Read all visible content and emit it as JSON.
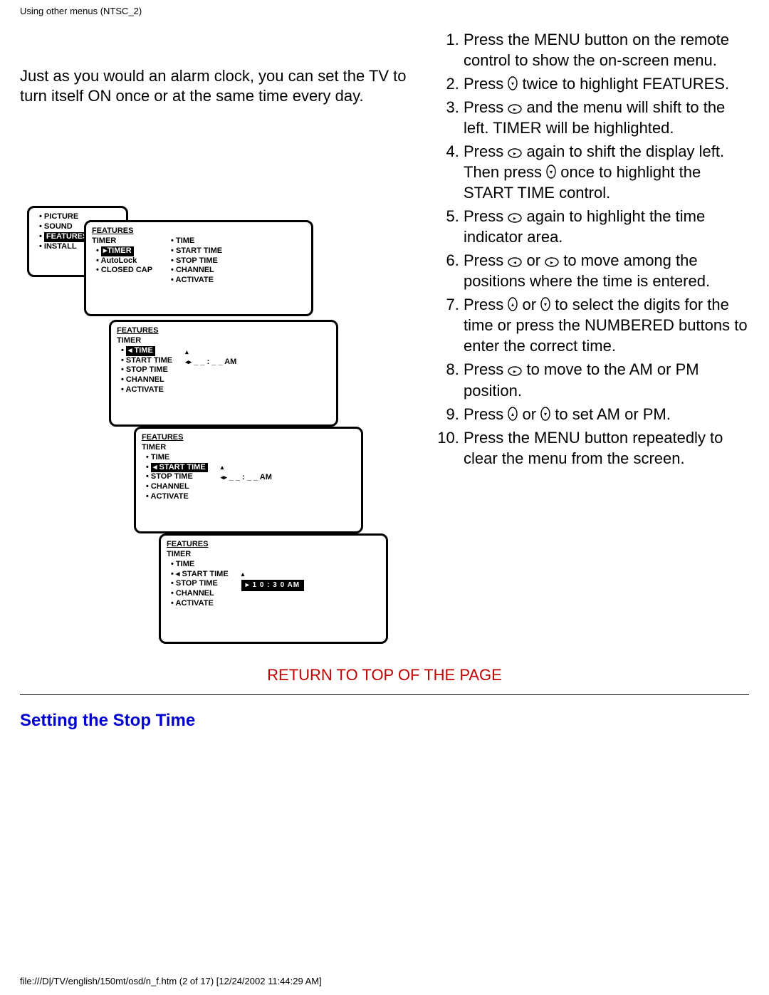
{
  "header_path": "Using other menus (NTSC_2)",
  "footer_path": "file:///D|/TV/english/150mt/osd/n_f.htm (2 of 17) [12/24/2002 11:44:29 AM]",
  "intro": "Just as you would an alarm clock, you can set the TV to turn itself ON once or at the same time every day.",
  "steps": [
    "Press the MENU button on the remote control to show the on-screen menu.",
    "Press {down} twice to highlight FEATURES.",
    "Press {right} and the menu will shift to the left. TIMER will be highlighted.",
    "Press {right} again to shift the display left. Then press {down} once to highlight the START TIME control.",
    "Press {right} again to highlight the time indicator area.",
    "Press {left} or {right} to move among the positions where the time is entered.",
    "Press {up} or {down} to select the digits for the time or press the NUMBERED buttons to enter the correct time.",
    "Press {right} to move to the AM or PM position.",
    "Press {up} or {down} to set AM or PM.",
    "Press the MENU button repeatedly to clear the menu from the screen."
  ],
  "return_link": "RETURN TO TOP OF THE PAGE",
  "section_title": "Setting the Stop Time",
  "card0": {
    "items": [
      "PICTURE",
      "SOUND",
      "FEATURES",
      "INSTALL"
    ],
    "highlight": 2
  },
  "card1": {
    "title": "FEATURES",
    "colA_header": "TIMER",
    "colA": [
      "TIMER",
      "AutoLock",
      "CLOSED CAP"
    ],
    "colA_highlight": 0,
    "colB": [
      "TIME",
      "START TIME",
      "STOP TIME",
      "CHANNEL",
      "ACTIVATE"
    ]
  },
  "card2": {
    "title": "FEATURES",
    "sub": "TIMER",
    "items": [
      "TIME",
      "START TIME",
      "STOP TIME",
      "CHANNEL",
      "ACTIVATE"
    ],
    "highlight": 0,
    "time_str": "_ _ : _ _   AM"
  },
  "card3": {
    "title": "FEATURES",
    "sub": "TIMER",
    "items": [
      "TIME",
      "START TIME",
      "STOP TIME",
      "CHANNEL",
      "ACTIVATE"
    ],
    "highlight": 1,
    "time_str": "_ _ : _ _   AM"
  },
  "card4": {
    "title": "FEATURES",
    "sub": "TIMER",
    "items": [
      "TIME",
      "START TIME",
      "STOP TIME",
      "CHANNEL",
      "ACTIVATE"
    ],
    "bold": 1,
    "time_box": "▸ 1 0 : 3 0  AM"
  }
}
